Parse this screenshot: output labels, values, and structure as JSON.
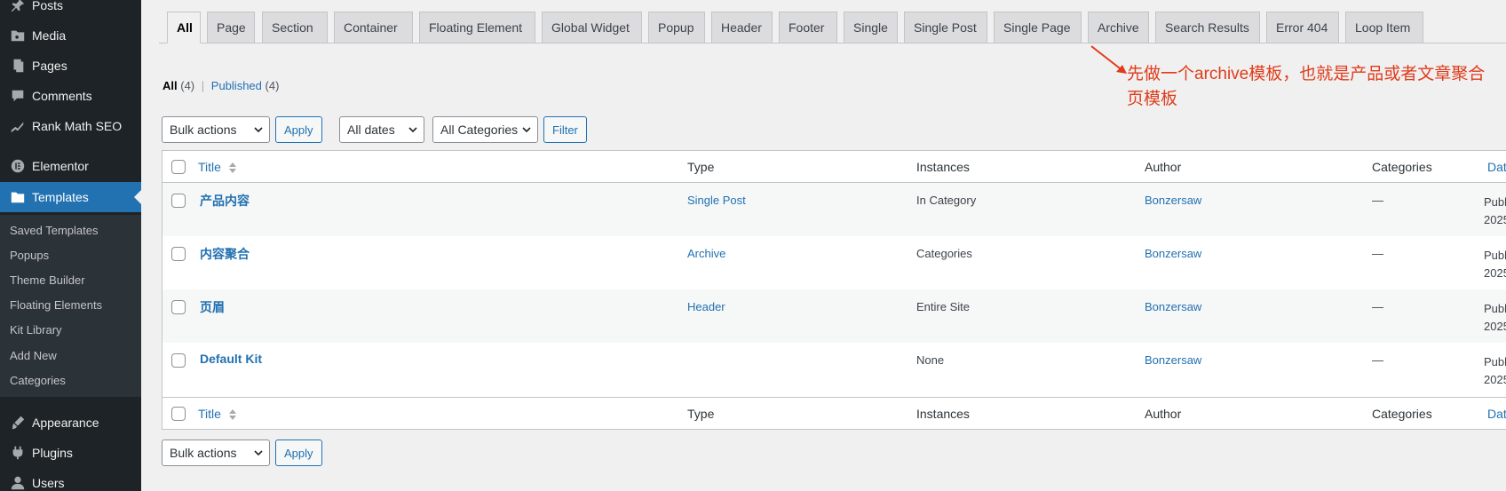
{
  "sidebar": {
    "items": [
      {
        "label": "Posts",
        "icon": "pin-icon"
      },
      {
        "label": "Media",
        "icon": "media-icon"
      },
      {
        "label": "Pages",
        "icon": "pages-icon"
      },
      {
        "label": "Comments",
        "icon": "comments-icon"
      },
      {
        "label": "Rank Math SEO",
        "icon": "rank-math-icon"
      },
      {
        "label": "Elementor",
        "icon": "elementor-icon"
      },
      {
        "label": "Templates",
        "icon": "folder-icon"
      },
      {
        "label": "Appearance",
        "icon": "brush-icon"
      },
      {
        "label": "Plugins",
        "icon": "plugin-icon"
      },
      {
        "label": "Users",
        "icon": "users-icon"
      }
    ],
    "submenu": [
      "Saved Templates",
      "Popups",
      "Theme Builder",
      "Floating Elements",
      "Kit Library",
      "Add New",
      "Categories"
    ]
  },
  "tabs": [
    "All",
    "Page",
    "Section",
    "Container",
    "Floating Element",
    "Global Widget",
    "Popup",
    "Header",
    "Footer",
    "Single",
    "Single Post",
    "Single Page",
    "Archive",
    "Search Results",
    "Error 404",
    "Loop Item"
  ],
  "annotation": "先做一个archive模板，也就是产品或者文章聚合页模板",
  "views": {
    "all_label": "All",
    "all_count": "(4)",
    "separator": "|",
    "published_label": "Published",
    "published_count": "(4)"
  },
  "filters": {
    "bulk_actions": "Bulk actions",
    "apply": "Apply",
    "all_dates": "All dates",
    "all_categories": "All Categories",
    "filter": "Filter"
  },
  "table": {
    "columns": {
      "title": "Title",
      "type": "Type",
      "instances": "Instances",
      "author": "Author",
      "categories": "Categories",
      "date": "Date"
    },
    "rows": [
      {
        "title": "产品内容",
        "type": "Single Post",
        "instances": "In Category",
        "author": "Bonzersaw",
        "categories": "—",
        "date1": "Publ",
        "date2": "2025"
      },
      {
        "title": "内容聚合",
        "type": "Archive",
        "instances": "Categories",
        "author": "Bonzersaw",
        "categories": "—",
        "date1": "Publ",
        "date2": "2025"
      },
      {
        "title": "页眉",
        "type": "Header",
        "instances": "Entire Site",
        "author": "Bonzersaw",
        "categories": "—",
        "date1": "Publ",
        "date2": "2025"
      },
      {
        "title": "Default Kit",
        "type": "",
        "instances": "None",
        "author": "Bonzersaw",
        "categories": "—",
        "date1": "Publ",
        "date2": "2025"
      }
    ]
  },
  "colors": {
    "sidebar_bg": "#1d2327",
    "active": "#2271b1",
    "annotation": "#e03c1a"
  }
}
